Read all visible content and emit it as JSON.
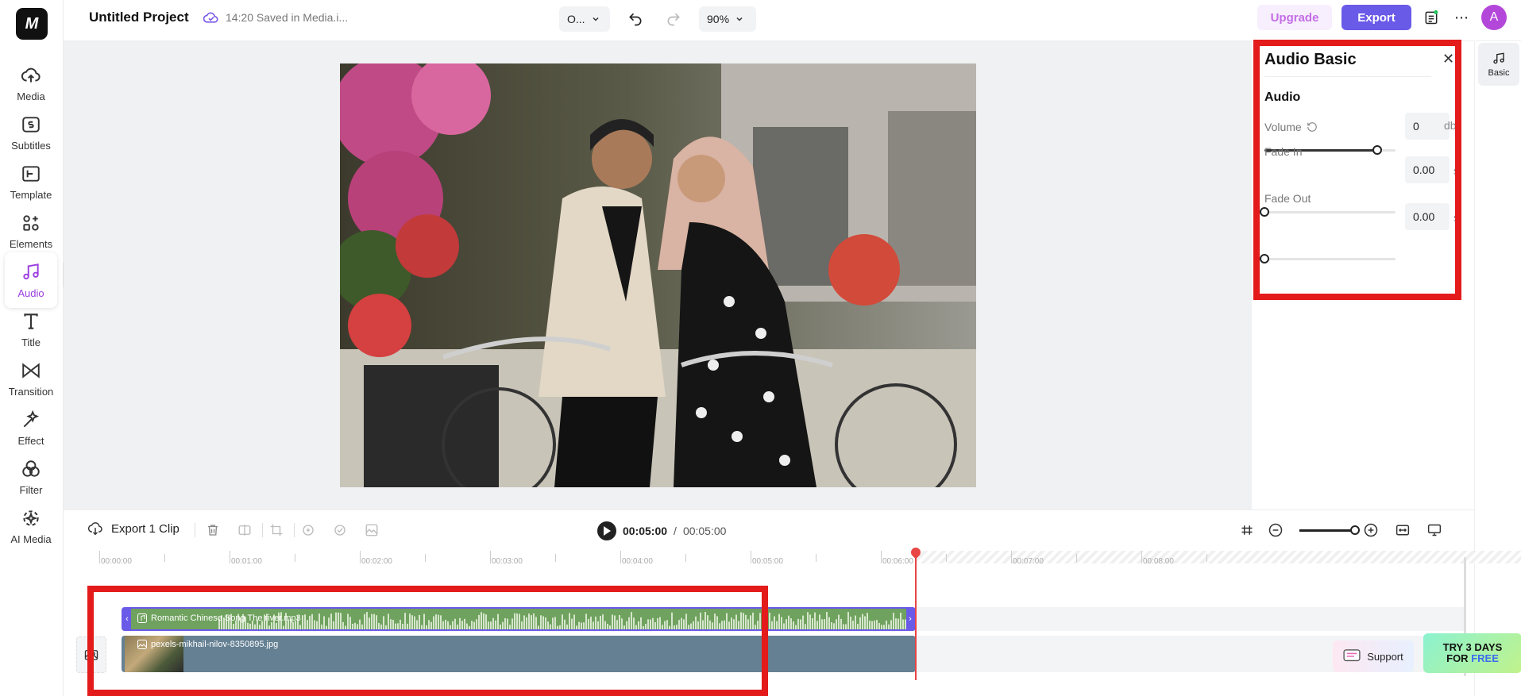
{
  "app": {
    "logo_text": "M"
  },
  "header": {
    "project_title": "Untitled Project",
    "save_status": "14:20 Saved in Media.i...",
    "aspect_select": "O...",
    "zoom": "90%",
    "upgrade_label": "Upgrade",
    "export_label": "Export",
    "avatar_letter": "A"
  },
  "sidebar": {
    "items": [
      {
        "label": "Media",
        "icon": "cloud-upload-icon"
      },
      {
        "label": "Subtitles",
        "icon": "subtitles-icon"
      },
      {
        "label": "Template",
        "icon": "template-icon"
      },
      {
        "label": "Elements",
        "icon": "elements-icon"
      },
      {
        "label": "Audio",
        "icon": "music-note-icon",
        "active": true
      },
      {
        "label": "Title",
        "icon": "text-icon"
      },
      {
        "label": "Transition",
        "icon": "transition-icon"
      },
      {
        "label": "Effect",
        "icon": "effect-icon"
      },
      {
        "label": "Filter",
        "icon": "filter-icon"
      },
      {
        "label": "AI Media",
        "icon": "ai-media-icon"
      }
    ]
  },
  "panel": {
    "title": "Audio Basic",
    "section": "Audio",
    "volume": {
      "label": "Volume",
      "value": "0",
      "unit": "db",
      "level": 0.86
    },
    "fade_in": {
      "label": "Fade In",
      "value": "0.00",
      "unit": "s",
      "level": 0.0
    },
    "fade_out": {
      "label": "Fade Out",
      "value": "0.00",
      "unit": "s",
      "level": 0.0
    }
  },
  "right_rail": {
    "tab_label": "Basic"
  },
  "toolbar": {
    "export_clip_label": "Export 1 Clip",
    "current_time": "00:05:00",
    "separator": "/",
    "total_time": "00:05:00"
  },
  "timeline": {
    "ticks": [
      "00:00:00",
      "00:01:00",
      "00:02:00",
      "00:03:00",
      "00:04:00",
      "00:05:00",
      "00:06:00",
      "00:07:00",
      "00:08:00"
    ],
    "audio_clip_name": "Romantic Chinese Song The river.mp3",
    "video_clip_name": "pexels-mikhail-nilov-8350895.jpg"
  },
  "support_label": "Support",
  "promo": {
    "line1": "TRY 3 DAYS",
    "line2_prefix": "FOR ",
    "line2_highlight": "FREE"
  },
  "colors": {
    "accent": "#6a5ae8",
    "highlight_box": "#e31b1b",
    "playhead": "#e84545",
    "audio_clip": "#6fa25e",
    "video_clip": "#658093"
  }
}
